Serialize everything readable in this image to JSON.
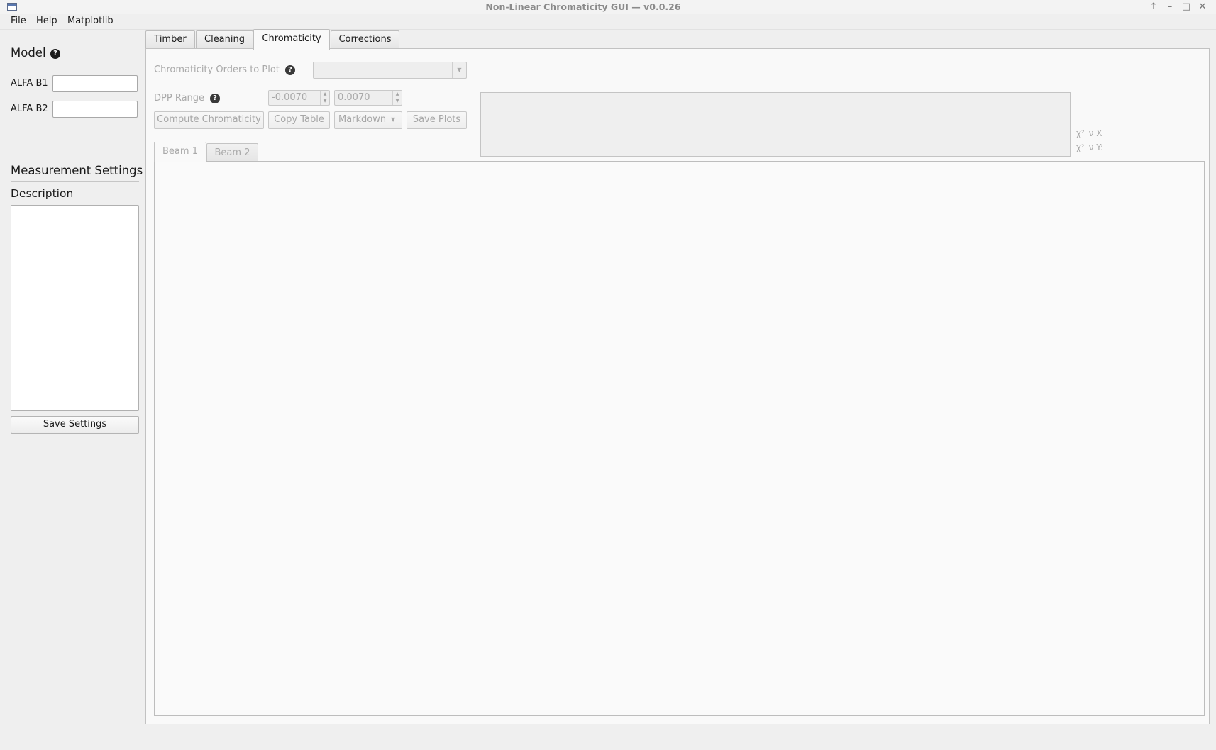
{
  "window": {
    "title": "Non-Linear Chromaticity GUI — v0.0.26",
    "controls": [
      "↑",
      "–",
      "□",
      "✕"
    ]
  },
  "menubar": {
    "items": [
      "File",
      "Help",
      "Matplotlib"
    ]
  },
  "left_panel": {
    "model_heading": "Model",
    "help_glyph": "?",
    "alfa_b1_label": "ALFA B1",
    "alfa_b1_value": "",
    "alfa_b2_label": "ALFA B2",
    "alfa_b2_value": "",
    "measurement_heading": "Measurement Settings",
    "description_label": "Description",
    "description_value": "",
    "save_settings_label": "Save Settings"
  },
  "tabs": [
    {
      "label": "Timber",
      "active": false
    },
    {
      "label": "Cleaning",
      "active": false
    },
    {
      "label": "Chromaticity",
      "active": true
    },
    {
      "label": "Corrections",
      "active": false
    }
  ],
  "chromaticity": {
    "orders_label": "Chromaticity Orders to Plot",
    "orders_value": "",
    "dpp_label": "DPP Range",
    "dpp_min": "-0.0070",
    "dpp_max": "0.0070",
    "compute_label": "Compute Chromaticity",
    "copy_table_label": "Copy Table",
    "format_value": "Markdown",
    "save_plots_label": "Save Plots",
    "chi_x_label": "χ²_ν X",
    "chi_y_label": "χ²_ν Y:",
    "beam_tabs": [
      {
        "label": "Beam 1",
        "active": true
      },
      {
        "label": "Beam 2",
        "active": false
      }
    ]
  },
  "icons": {
    "help": "question-circle-icon",
    "dropdown": "chevron-down-icon",
    "spin": "spin-arrows-icon",
    "resize": "resize-grip-icon"
  }
}
